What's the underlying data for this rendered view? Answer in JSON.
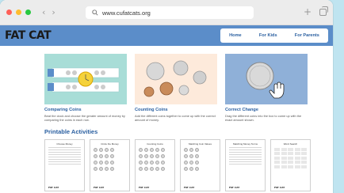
{
  "browser": {
    "url": "www.cufatcats.org",
    "back_glyph": "‹",
    "forward_glyph": "›",
    "new_tab_glyph": "+"
  },
  "site": {
    "logo": "FAT CAT",
    "nav": [
      "Home",
      "For Kids",
      "For Parents"
    ]
  },
  "activities": [
    {
      "title": "Comparing Coins",
      "description": "Beat the clock and choose the greater amount of money by comparing the coins in each row."
    },
    {
      "title": "Counting Coins",
      "description": "Add the different coins together to come up with the correct amount of money."
    },
    {
      "title": "Correct Change",
      "description": "Drag the different coins into the box to come up with the exact amount shown."
    }
  ],
  "printables_title": "Printable Activities",
  "printables": [
    {
      "title": "Choose Money",
      "brand": "FAT CAT"
    },
    {
      "title": "Circle the Money",
      "brand": "FAT CAT"
    },
    {
      "title": "Counting Coins",
      "brand": "FAT CAT"
    },
    {
      "title": "Matching Coin Values",
      "brand": "FAT CAT"
    },
    {
      "title": "Matching Money Terms",
      "brand": "FAT CAT"
    },
    {
      "title": "Word Search",
      "brand": "FAT CAT"
    }
  ],
  "colors": {
    "page_bg": "#bfe4f0",
    "header": "#5b8dc9",
    "accent_text": "#2a5fa0",
    "traffic_red": "#ff5f57",
    "traffic_yellow": "#febc2e",
    "traffic_green": "#28c840"
  }
}
